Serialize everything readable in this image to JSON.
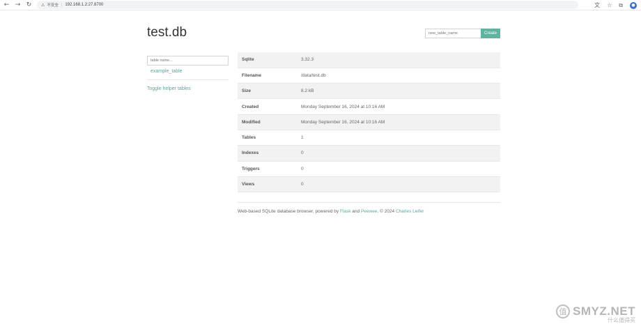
{
  "browser": {
    "back_icon": "arrow-left-icon",
    "forward_icon": "arrow-right-icon",
    "reload_icon": "reload-icon",
    "security_label": "不安全",
    "url": "192.168.1.2:27.8700",
    "icons": [
      "translate-icon",
      "star-icon",
      "extensions-icon",
      "profile-icon"
    ]
  },
  "page": {
    "title": "test.db",
    "create_placeholder": "new_table_name",
    "create_button": "Create"
  },
  "sidebar": {
    "filter_placeholder": "table name...",
    "tables": [
      "example_table"
    ],
    "toggle_helper": "Toggle helper tables"
  },
  "info_rows": [
    {
      "key": "Sqlite",
      "value": "3.32.3"
    },
    {
      "key": "Filename",
      "value": "/data/test.db"
    },
    {
      "key": "Size",
      "value": "8.2 kB"
    },
    {
      "key": "Created",
      "value": "Monday September 16, 2024 at 10:16 AM"
    },
    {
      "key": "Modified",
      "value": "Monday September 16, 2024 at 10:16 AM"
    },
    {
      "key": "Tables",
      "value": "1"
    },
    {
      "key": "Indexes",
      "value": "0"
    },
    {
      "key": "Triggers",
      "value": "0"
    },
    {
      "key": "Views",
      "value": "0"
    }
  ],
  "footer": {
    "prefix": "Web-based SQLite database browser, powered by ",
    "flask": "Flask",
    "and": " and ",
    "peewee": "Peewee",
    "copyright": ". © 2024 ",
    "author": "Charles Leifer"
  },
  "watermark": {
    "seal": "值",
    "brand": "SMYZ.NET",
    "sub": "什么值得买"
  }
}
